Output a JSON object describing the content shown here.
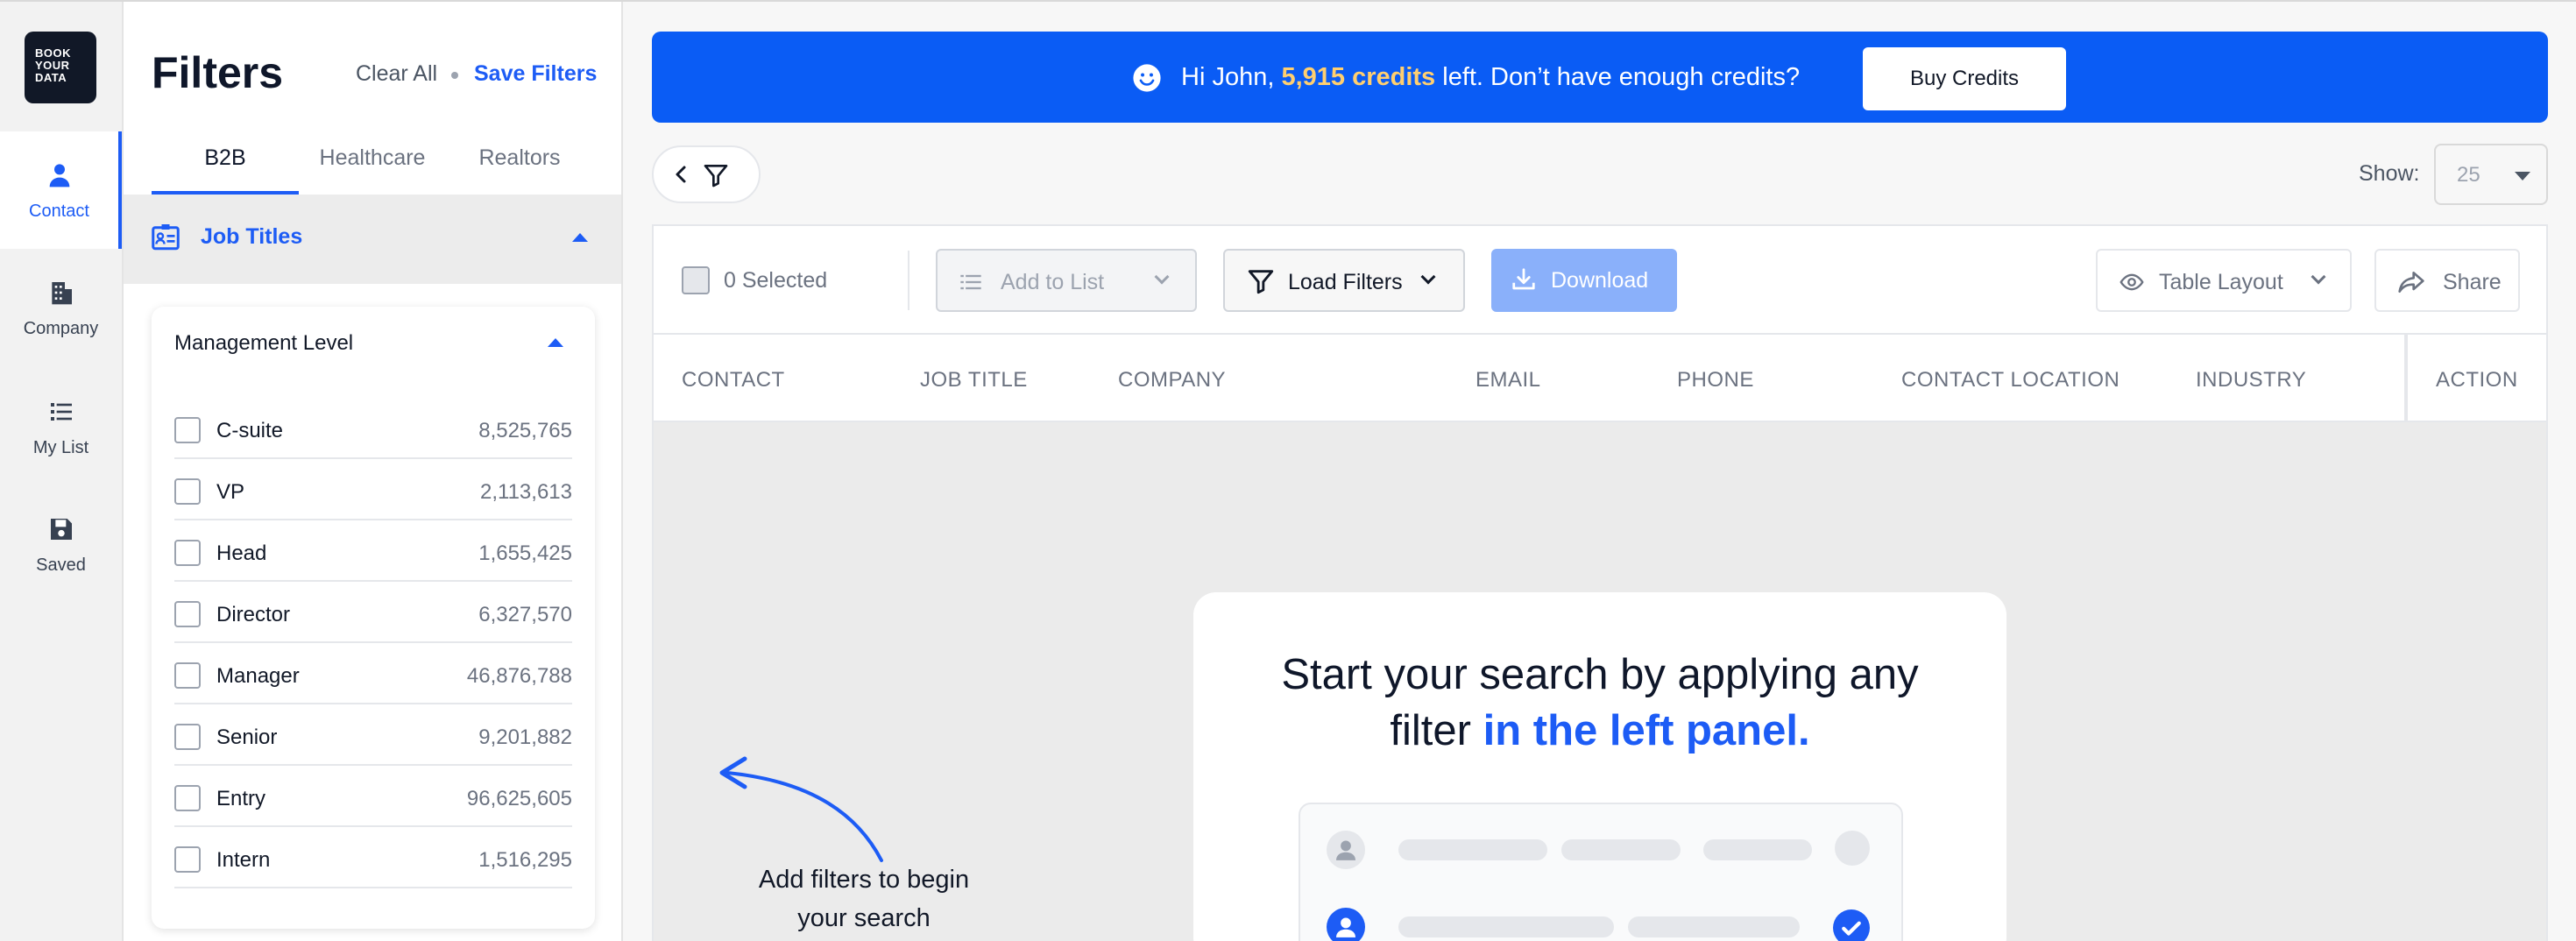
{
  "brand": {
    "logo_text": "BOOK YOUR DATA"
  },
  "nav": {
    "items": [
      {
        "label": "Contact",
        "icon": "person-icon",
        "active": true
      },
      {
        "label": "Company",
        "icon": "building-icon",
        "active": false
      },
      {
        "label": "My List",
        "icon": "list-icon",
        "active": false
      },
      {
        "label": "Saved",
        "icon": "floppy-disk-icon",
        "active": false
      }
    ]
  },
  "filters": {
    "title": "Filters",
    "clear_all": "Clear All",
    "save_filters": "Save Filters",
    "tabs": [
      "B2B",
      "Healthcare",
      "Realtors"
    ],
    "active_tab": "B2B",
    "section_title": "Job Titles",
    "group_title": "Management Level",
    "options": [
      {
        "label": "C-suite",
        "count": "8,525,765"
      },
      {
        "label": "VP",
        "count": "2,113,613"
      },
      {
        "label": "Head",
        "count": "1,655,425"
      },
      {
        "label": "Director",
        "count": "6,327,570"
      },
      {
        "label": "Manager",
        "count": "46,876,788"
      },
      {
        "label": "Senior",
        "count": "9,201,882"
      },
      {
        "label": "Entry",
        "count": "96,625,605"
      },
      {
        "label": "Intern",
        "count": "1,516,295"
      }
    ]
  },
  "banner": {
    "greeting": "Hi John,",
    "credits": "5,915 credits",
    "rest": "left. Don’t have enough credits?",
    "button": "Buy Credits"
  },
  "show": {
    "label": "Show:",
    "value": "25"
  },
  "toolbar": {
    "selected": "0 Selected",
    "add_to_list": "Add to List",
    "load_filters": "Load Filters",
    "download": "Download",
    "table_layout": "Table Layout",
    "share": "Share"
  },
  "table": {
    "columns": [
      "CONTACT",
      "JOB TITLE",
      "COMPANY",
      "EMAIL",
      "PHONE",
      "CONTACT LOCATION",
      "INDUSTRY",
      "ACTION"
    ]
  },
  "empty_state": {
    "heading_1": "Start your search by applying any",
    "heading_2a": "filter",
    "heading_2b": "in the left panel.",
    "hint_1": "Add filters to begin",
    "hint_2": "your search"
  },
  "colors": {
    "accent": "#1d5cf5",
    "banner": "#0a5cf5",
    "credits_highlight": "#ffcf70"
  }
}
